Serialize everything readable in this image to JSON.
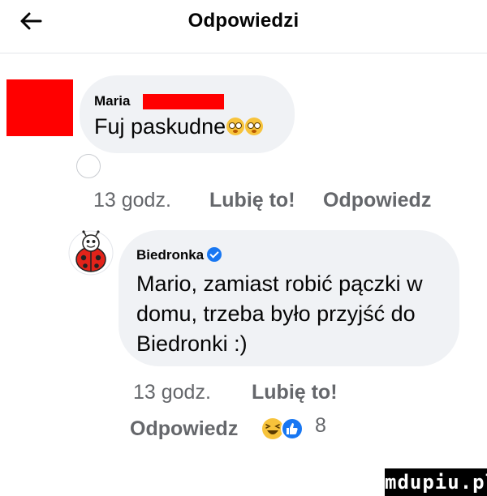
{
  "header": {
    "title": "Odpowiedzi",
    "back_icon": "arrow-left-icon"
  },
  "comment": {
    "author": "Maria",
    "text": "Fuj paskudne",
    "emojis": [
      "flushed-face-icon",
      "flushed-face-icon"
    ],
    "time": "13 godz.",
    "like_label": "Lubię to!",
    "reply_label": "Odpowiedz"
  },
  "reply": {
    "author": "Biedronka",
    "verified_icon": "verified-badge-icon",
    "text_lines": [
      "Mario, zamiast robić pączki w",
      "domu, trzeba było przyjść do",
      "Biedronki :)"
    ],
    "time": "13 godz.",
    "like_label": "Lubię to!",
    "reply_label": "Odpowiedz",
    "reaction_icons": [
      "haha-icon",
      "like-icon"
    ],
    "reaction_count": "8"
  },
  "watermark": "mdupiu.pl",
  "colors": {
    "accent": "#1877f2",
    "redaction": "#ff0000",
    "bubble": "#f0f2f5",
    "meta_text": "#65676b"
  }
}
